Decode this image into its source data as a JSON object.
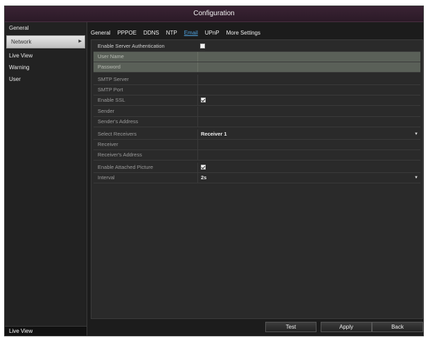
{
  "window": {
    "title": "Configuration"
  },
  "sidebar": {
    "items": [
      {
        "label": "General"
      },
      {
        "label": "Network"
      },
      {
        "label": "Live View"
      },
      {
        "label": "Warning"
      },
      {
        "label": "User"
      }
    ],
    "active_index": 1,
    "bottom_label": "Live View"
  },
  "tabs": [
    {
      "label": "General"
    },
    {
      "label": "PPPOE"
    },
    {
      "label": "DDNS"
    },
    {
      "label": "NTP"
    },
    {
      "label": "Email"
    },
    {
      "label": "UPnP"
    },
    {
      "label": "More Settings"
    }
  ],
  "active_tab": "Email",
  "form": {
    "enable_auth": {
      "label": "Enable Server Authentication",
      "checked": false
    },
    "user_name": {
      "label": "User Name",
      "value": ""
    },
    "password": {
      "label": "Password",
      "value": ""
    },
    "smtp_server": {
      "label": "SMTP Server",
      "value": ""
    },
    "smtp_port": {
      "label": "SMTP Port",
      "value": ""
    },
    "enable_ssl": {
      "label": "Enable SSL",
      "checked": true
    },
    "sender": {
      "label": "Sender",
      "value": ""
    },
    "sender_address": {
      "label": "Sender's Address",
      "value": ""
    },
    "select_receivers": {
      "label": "Select Receivers",
      "value": "Receiver 1"
    },
    "receiver": {
      "label": "Receiver",
      "value": ""
    },
    "receiver_address": {
      "label": "Receiver's Address",
      "value": ""
    },
    "enable_attached_picture": {
      "label": "Enable Attached Picture",
      "checked": true
    },
    "interval": {
      "label": "Interval",
      "value": "2s"
    }
  },
  "buttons": {
    "test": "Test",
    "apply": "Apply",
    "back": "Back"
  },
  "colors": {
    "title_bar": "#3a2334",
    "active_tab": "#4fa3e0",
    "disabled_row": "#5a6058"
  }
}
